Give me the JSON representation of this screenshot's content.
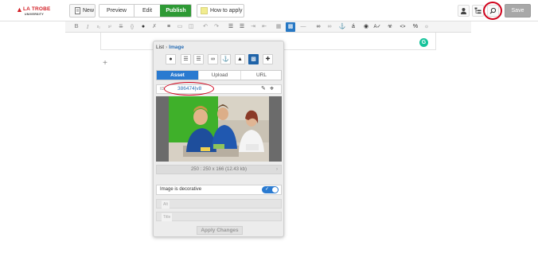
{
  "brand": {
    "name": "LA TROBE",
    "sub": "UNIVERSITY",
    "color": "#d31f26"
  },
  "header": {
    "new_label": "New",
    "preview_label": "Preview",
    "edit_label": "Edit",
    "publish_label": "Publish",
    "how_to_label": "How to apply",
    "save_label": "Save",
    "publish_color": "#2e9a35"
  },
  "toolbar": {
    "items": [
      "bold",
      "italic",
      "subscript",
      "superscript",
      "strikethrough",
      "code",
      "text-color",
      "clear-format",
      "align",
      "table-props",
      "split",
      "undo",
      "redo",
      "bullet-list",
      "numbered-list",
      "indent",
      "outdent",
      "table",
      "image",
      "horizontal-rule",
      "link",
      "unlink",
      "anchor",
      "special-char",
      "find",
      "spellcheck",
      "accessibility",
      "source",
      "percent",
      "more"
    ],
    "labels": {
      "bold": "B",
      "italic": "I",
      "percent": "%"
    }
  },
  "editor": {
    "grammarly_label": "G"
  },
  "panel": {
    "breadcrumb": [
      "List",
      "Image"
    ],
    "tabs": [
      "Asset",
      "Upload",
      "URL"
    ],
    "active_tab": "Asset",
    "id_label": "ID",
    "id_value": "386474|v8",
    "image_meta": "250 : 250 x 166 (12.43 kb)",
    "decorative_label": "Image is decorative",
    "decorative_on": true,
    "alt_placeholder": "Alt",
    "title_placeholder": "Title",
    "apply_label": "Apply Changes",
    "accent": "#2a7ad0"
  }
}
